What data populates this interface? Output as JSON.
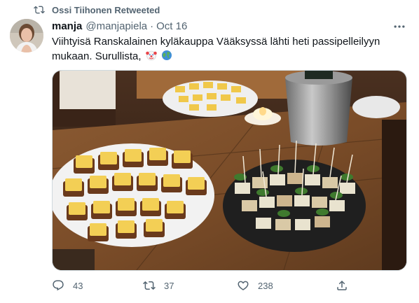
{
  "retweet_banner": {
    "text": "Ossi Tiihonen Retweeted",
    "icon": "retweet-icon"
  },
  "author": {
    "name": "manja",
    "handle": "@manjapiela",
    "separator": "·",
    "date": "Oct 16"
  },
  "tweet": {
    "text_line1": "Viihtyisä Ranskalainen kyläkauppa Vääksyssä lähti heti passipelleilyyn",
    "text_line2": "mukaan. Surullista,",
    "emojis": [
      "clown-face-icon",
      "globe-icon"
    ]
  },
  "media": {
    "description_icon": "photo"
  },
  "actions": {
    "reply": {
      "icon": "reply-icon",
      "count": "43"
    },
    "retweet": {
      "icon": "retweet-icon",
      "count": "37"
    },
    "like": {
      "icon": "heart-icon",
      "count": "238"
    },
    "share": {
      "icon": "share-icon"
    }
  },
  "colors": {
    "secondary_text": "#536471",
    "primary_text": "#0f1419",
    "border": "#cfd9de"
  }
}
